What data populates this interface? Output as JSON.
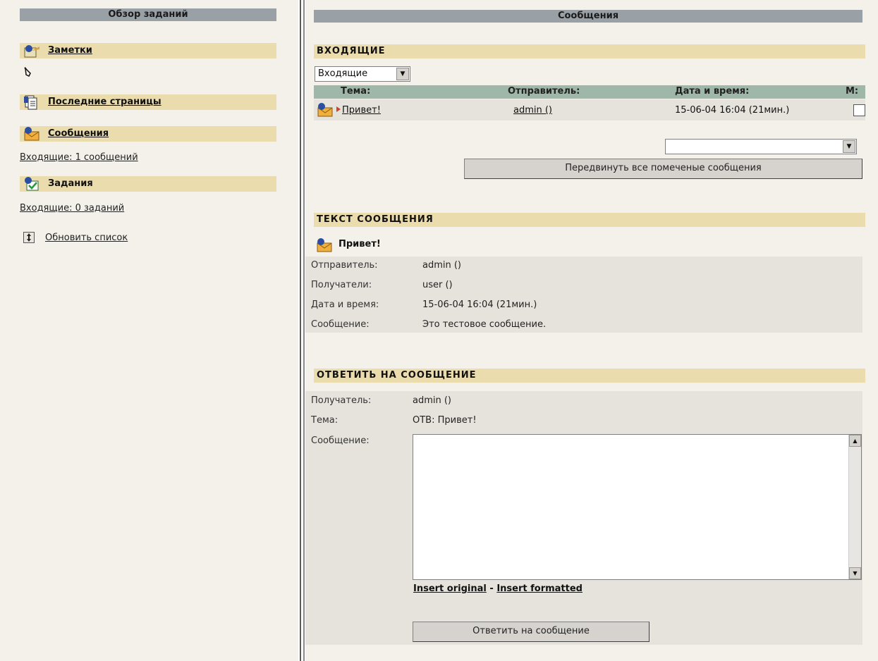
{
  "left": {
    "title": "Обзор заданий",
    "notes_label": "Заметки",
    "recent_label": "Последние страницы",
    "messages_label": "Сообщения",
    "messages_inbox": "Входящие: 1 сообщений",
    "tasks_label": "Задания",
    "tasks_inbox": "Входящие: 0 заданий",
    "refresh_label": "Обновить список"
  },
  "right": {
    "title": "Сообщения",
    "inbox_section": "ВХОДЯЩИЕ",
    "folder_select": "Входящие",
    "columns": {
      "subject": "Тема:",
      "sender": "Отправитель:",
      "datetime": "Дата и время:",
      "mark": "М:"
    },
    "messages": [
      {
        "subject": "Привет!",
        "sender": "admin ()",
        "datetime": "15-06-04 16:04 (21мин.)"
      }
    ],
    "move_select": "",
    "move_button": "Передвинуть все помеченые сообщения",
    "text_section": "ТЕКСТ СООБЩЕНИЯ",
    "message_title": "Привет!",
    "details": {
      "sender_label": "Отправитель:",
      "sender": "admin ()",
      "recipients_label": "Получатели:",
      "recipients": "user ()",
      "datetime_label": "Дата и время:",
      "datetime": "15-06-04 16:04 (21мин.)",
      "message_label": "Сообщение:",
      "message": "Это тестовое сообщение."
    },
    "reply_section": "ОТВЕТИТЬ НА СООБЩЕНИЕ",
    "reply": {
      "recipient_label": "Получатель:",
      "recipient": "admin ()",
      "subject_label": "Тема:",
      "subject": "ОТВ: Привет!",
      "message_label": "Сообщение:",
      "message_value": "",
      "insert_original": "Insert original",
      "insert_sep": "-",
      "insert_formatted": "Insert formatted",
      "submit": "Ответить на сообщение"
    }
  },
  "colors": {
    "panel_bg": "#f4f1ea",
    "section_bg": "#ebdcae",
    "titlebar_bg": "#9aa1a6",
    "list_header_bg": "#9fb7a8"
  }
}
